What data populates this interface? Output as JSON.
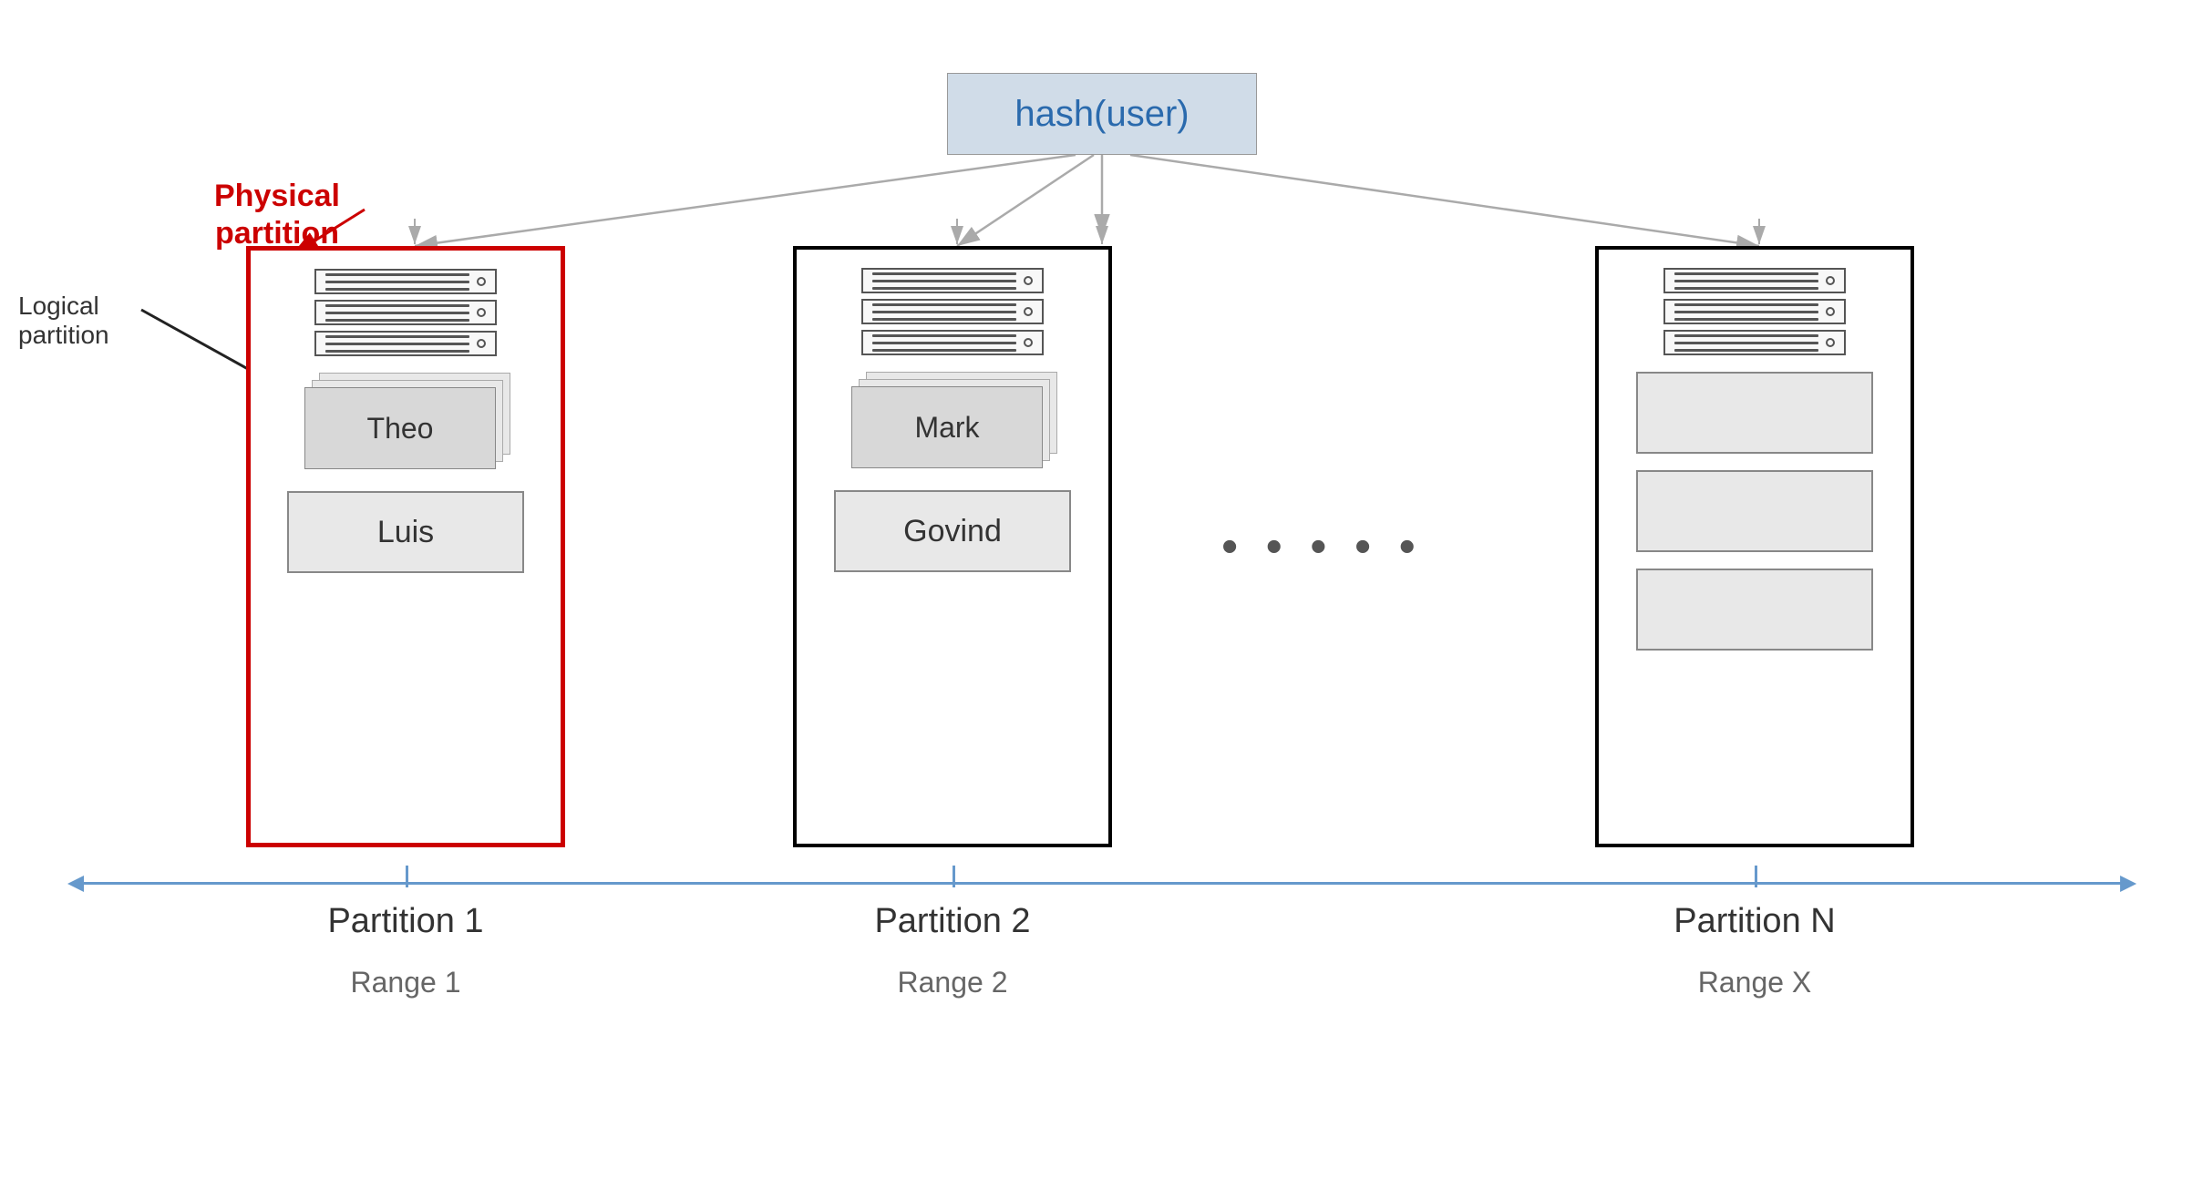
{
  "hash_box": {
    "label": "hash(user)"
  },
  "physical_partition_label": "Physical\npartition",
  "logical_partition_label": "Logical\npartition",
  "partitions": [
    {
      "id": "partition1",
      "label": "Partition 1",
      "range": "Range 1",
      "users": [
        "Theo",
        "Luis"
      ],
      "border": "red"
    },
    {
      "id": "partition2",
      "label": "Partition 2",
      "range": "Range 2",
      "users": [
        "Mark",
        "Govind"
      ],
      "border": "black"
    },
    {
      "id": "partitionN",
      "label": "Partition N",
      "range": "Range X",
      "users": [],
      "border": "black"
    }
  ],
  "dots": "• • • • •"
}
